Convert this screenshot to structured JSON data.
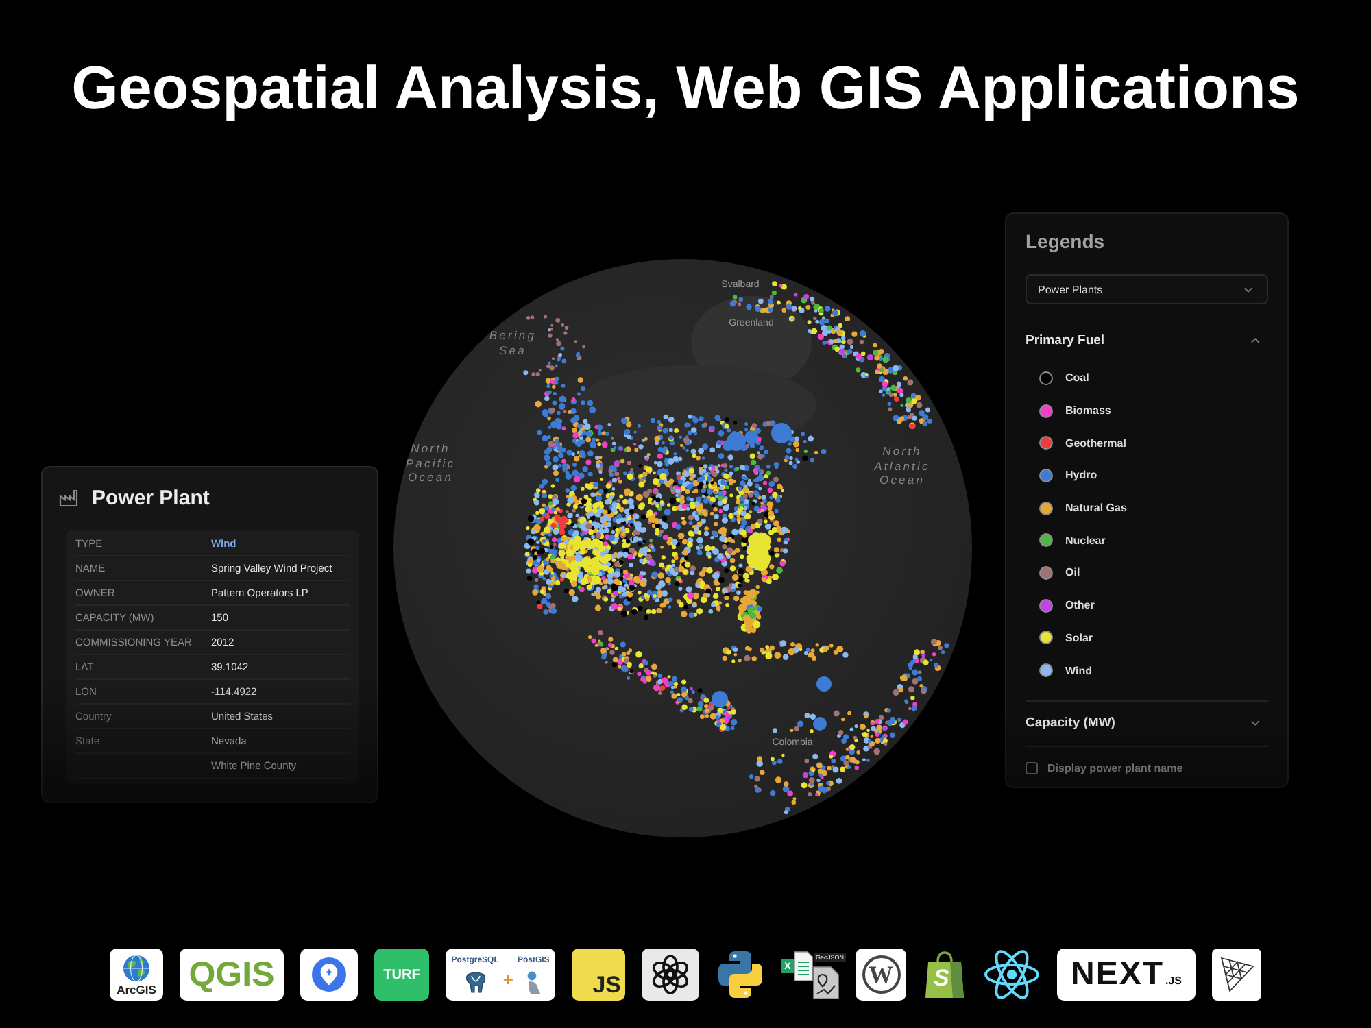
{
  "title": "Geospatial Analysis, Web GIS Applications",
  "globe": {
    "map_labels": [
      {
        "text": "Svalbard",
        "kind": "place"
      },
      {
        "text": "Greenland",
        "kind": "place"
      },
      {
        "text": "Bering Sea",
        "kind": "water"
      },
      {
        "text": "North Pacific Ocean",
        "kind": "water"
      },
      {
        "text": "North Atlantic Ocean",
        "kind": "water"
      },
      {
        "text": "Colombia",
        "kind": "place"
      }
    ]
  },
  "info_panel": {
    "title": "Power Plant",
    "rows": [
      {
        "label": "TYPE",
        "value": "Wind",
        "highlighted": true
      },
      {
        "label": "NAME",
        "value": "Spring Valley Wind Project",
        "highlighted": false
      },
      {
        "label": "OWNER",
        "value": "Pattern Operators LP",
        "highlighted": false
      },
      {
        "label": "CAPACITY (MW)",
        "value": "150",
        "highlighted": false
      },
      {
        "label": "COMMISSIONING YEAR",
        "value": "2012",
        "highlighted": false
      },
      {
        "label": "LAT",
        "value": "39.1042",
        "highlighted": false
      },
      {
        "label": "LON",
        "value": "-114.4922",
        "highlighted": false
      },
      {
        "label": "Country",
        "value": "United States",
        "highlighted": false
      },
      {
        "label": "State",
        "value": "Nevada",
        "highlighted": false
      },
      {
        "value": "White Pine County",
        "highlighted": false
      }
    ]
  },
  "legend_panel": {
    "title": "Legends",
    "layer_select": {
      "value": "Power Plants"
    },
    "sections": [
      {
        "title": "Primary Fuel",
        "expanded": true,
        "items": [
          {
            "label": "Coal",
            "color": "#000000"
          },
          {
            "label": "Biomass",
            "color": "#f23fc6"
          },
          {
            "label": "Geothermal",
            "color": "#f03c3c"
          },
          {
            "label": "Hydro",
            "color": "#3d7bd4"
          },
          {
            "label": "Natural Gas",
            "color": "#e8a838"
          },
          {
            "label": "Nuclear",
            "color": "#4cb840"
          },
          {
            "label": "Oil",
            "color": "#a27272"
          },
          {
            "label": "Other",
            "color": "#c442e6"
          },
          {
            "label": "Solar",
            "color": "#e8e432"
          },
          {
            "label": "Wind",
            "color": "#8ab8f0"
          }
        ]
      },
      {
        "title": "Capacity (MW)",
        "expanded": false
      }
    ],
    "checkbox": {
      "label": "Display power plant name",
      "checked": false
    }
  },
  "logos": [
    {
      "kind": "globe",
      "label": "ArcGIS"
    },
    {
      "kind": "wordmark",
      "label": "QGIS"
    },
    {
      "kind": "pin"
    },
    {
      "kind": "badge",
      "label": "TURF"
    },
    {
      "kind": "database-pair",
      "labels": [
        "PostgreSQL",
        "PostGIS"
      ],
      "joiner": "+"
    },
    {
      "kind": "corner-letters",
      "label": "JS"
    },
    {
      "kind": "knot"
    },
    {
      "kind": "snakes"
    },
    {
      "kind": "files",
      "labels": [
        "X",
        "GeoJSON"
      ]
    },
    {
      "kind": "ring-letter",
      "label": "W"
    },
    {
      "kind": "bag",
      "label": "S"
    },
    {
      "kind": "atom"
    },
    {
      "kind": "wordmark-suffix",
      "label": "NEXT",
      "suffix": ".JS"
    },
    {
      "kind": "mesh"
    }
  ]
}
